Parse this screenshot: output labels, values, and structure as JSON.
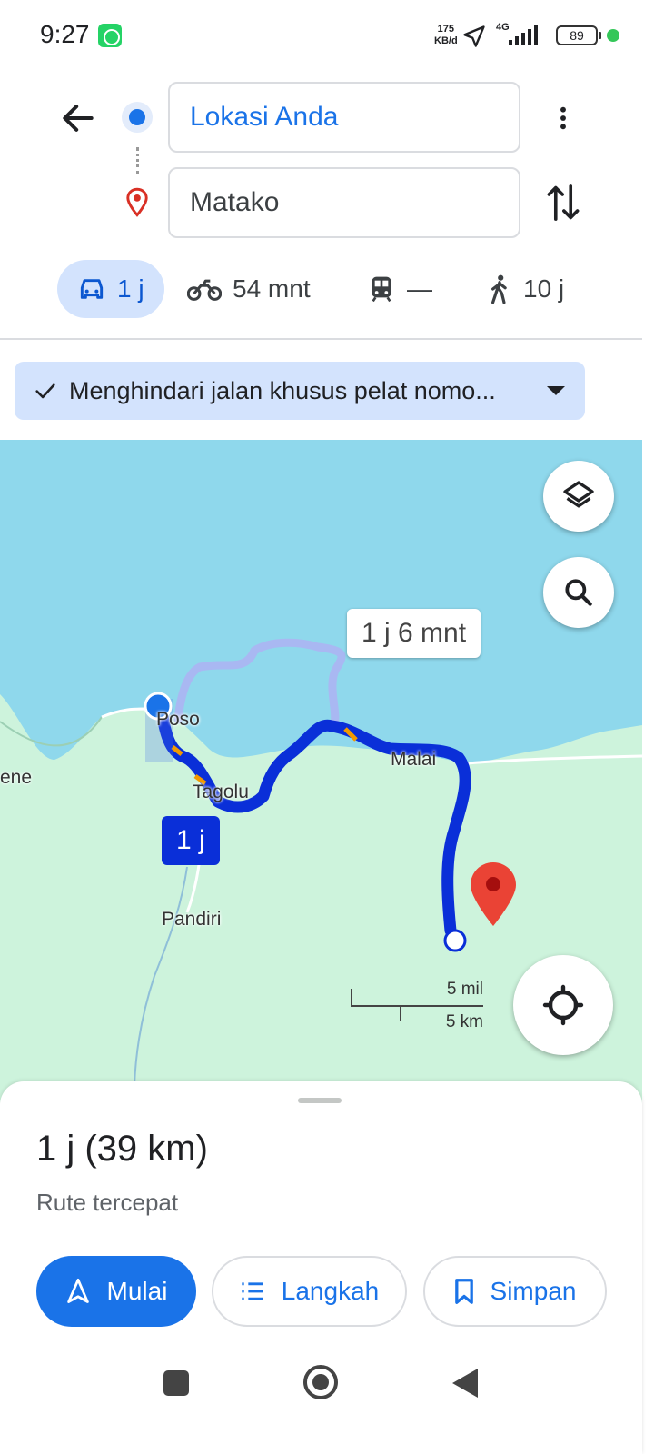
{
  "status_bar": {
    "time": "9:27",
    "net_speed": "175",
    "net_unit": "KB/d",
    "network": "4G",
    "battery": "89"
  },
  "search": {
    "origin": "Lokasi Anda",
    "destination": "Matako"
  },
  "modes": [
    {
      "name": "car",
      "label": "1 j",
      "active": true
    },
    {
      "name": "motorcycle",
      "label": "54 mnt"
    },
    {
      "name": "transit",
      "label": "—"
    },
    {
      "name": "walk",
      "label": "10 j"
    }
  ],
  "filter_chip": {
    "label": "Menghindari jalan khusus pelat nomo..."
  },
  "map": {
    "alt_route_label": "1 j 6 mnt",
    "main_route_label": "1 j",
    "places": [
      "Poso",
      "Tagolu",
      "Malai",
      "Pandiri",
      "ene"
    ],
    "scale_miles": "5 mil",
    "scale_km": "5 km",
    "colors": {
      "water": "#8fd8ec",
      "land": "#cdf3dc",
      "route": "#0a2fd8",
      "alt_route": "#a9b8f2",
      "destination_pin": "#ea4335"
    }
  },
  "sheet": {
    "summary": "1 j (39 km)",
    "subtitle": "Rute tercepat",
    "start": "Mulai",
    "steps": "Langkah",
    "save": "Simpan"
  }
}
